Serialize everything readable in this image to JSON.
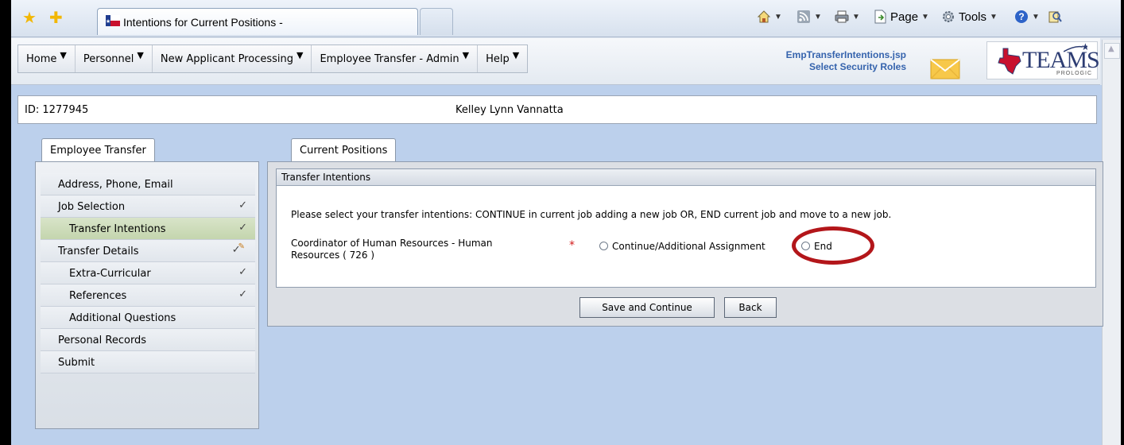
{
  "browser": {
    "tab_title": "Intentions for Current Positions -",
    "commands": {
      "page_label": "Page",
      "tools_label": "Tools"
    }
  },
  "app": {
    "nav": [
      {
        "label": "Home"
      },
      {
        "label": "Personnel"
      },
      {
        "label": "New Applicant Processing"
      },
      {
        "label": "Employee Transfer - Admin"
      },
      {
        "label": "Help"
      }
    ],
    "page_file": "EmpTransferIntentions.jsp",
    "security_link": "Select Security Roles",
    "logo_text": "TEAMS",
    "logo_sub": "PROLOGIC"
  },
  "employee": {
    "id_text": "ID: 1277945",
    "name": "Kelley Lynn Vannatta"
  },
  "left": {
    "tab_label": "Employee Transfer",
    "menu": [
      {
        "label": "Address, Phone, Email",
        "check": ""
      },
      {
        "label": "Job Selection",
        "check": "✓"
      },
      {
        "label": "Transfer Intentions",
        "check": "✓"
      },
      {
        "label": "Transfer Details",
        "check": "✓"
      },
      {
        "label": "Extra-Curricular",
        "check": "✓"
      },
      {
        "label": "References",
        "check": "✓"
      },
      {
        "label": "Additional Questions",
        "check": ""
      },
      {
        "label": "Personal Records",
        "check": ""
      },
      {
        "label": "Submit",
        "check": ""
      }
    ]
  },
  "main": {
    "tab_label": "Current Positions",
    "section_title": "Transfer Intentions",
    "instructions": "Please select your transfer intentions: CONTINUE in current job adding a new job OR, END current job and move to a new job.",
    "position_label": "Coordinator of Human Resources - Human Resources ( 726 )",
    "required_mark": "*",
    "option_continue": "Continue/Additional Assignment",
    "option_end": "End",
    "save_label": "Save and Continue",
    "back_label": "Back"
  },
  "colors": {
    "accent_blue": "#3563ad",
    "highlight_red": "#b3161a",
    "required_red": "#d21b1b",
    "page_background": "#bcd0ec"
  }
}
